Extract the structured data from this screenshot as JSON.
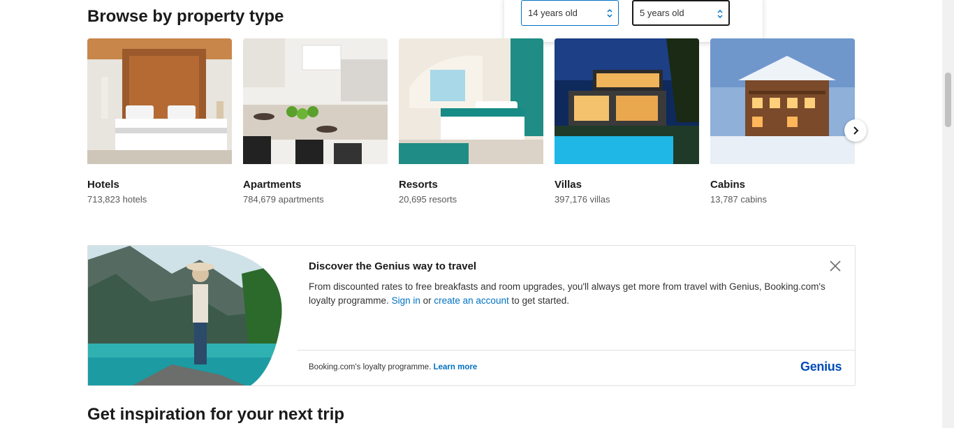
{
  "browse": {
    "title": "Browse by property type",
    "cards": [
      {
        "name": "Hotels",
        "count": "713,823 hotels",
        "image": "hotel-bedroom"
      },
      {
        "name": "Apartments",
        "count": "784,679 apartments",
        "image": "apartment-kitchen"
      },
      {
        "name": "Resorts",
        "count": "20,695 resorts",
        "image": "resort-room"
      },
      {
        "name": "Villas",
        "count": "397,176 villas",
        "image": "villa-pool"
      },
      {
        "name": "Cabins",
        "count": "13,787 cabins",
        "image": "snow-cabin"
      }
    ],
    "next_icon": "chevron-right-icon"
  },
  "age_popup": {
    "child1": "14 years old",
    "child2": "5 years old"
  },
  "genius": {
    "title": "Discover the Genius way to travel",
    "body_text": "From discounted rates to free breakfasts and room upgrades, you'll always get more from travel with Genius, Booking.com's loyalty programme.",
    "sign_in": "Sign in",
    "or": "or",
    "create_account": "create an account",
    "to_get_started": "to get started.",
    "footer_text": "Booking.com's loyalty programme.",
    "learn_more": "Learn more",
    "logo": "Genius",
    "image": "woman-lake-mountains",
    "close_icon": "close-icon"
  },
  "inspiration": {
    "title": "Get inspiration for your next trip"
  },
  "colors": {
    "link": "#0071c2",
    "genius_logo": "#004cb8",
    "text": "#1a1a1a"
  }
}
